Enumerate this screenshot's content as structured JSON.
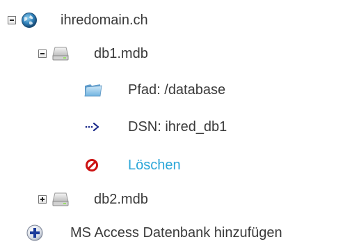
{
  "tree": {
    "domain": {
      "label": "ihredomain.ch",
      "icon": "globe-icon",
      "expanded": true
    },
    "databases": [
      {
        "label": "db1.mdb",
        "icon": "database-drive-icon",
        "expanded": true,
        "children": {
          "path": {
            "label": "Pfad: /database",
            "icon": "folder-icon"
          },
          "dsn": {
            "label": "DSN: ihred_db1",
            "icon": "dotted-arrow-icon"
          },
          "delete": {
            "label": "Löschen",
            "icon": "delete-icon"
          }
        }
      },
      {
        "label": "db2.mdb",
        "icon": "database-drive-icon",
        "expanded": false
      }
    ],
    "add": {
      "label": "MS Access Datenbank hinzufügen",
      "icon": "add-plus-icon"
    }
  },
  "colors": {
    "text": "#3a3a3a",
    "link": "#2aa6d8",
    "delete": "#cc1111",
    "add": "#1a3a9a"
  }
}
